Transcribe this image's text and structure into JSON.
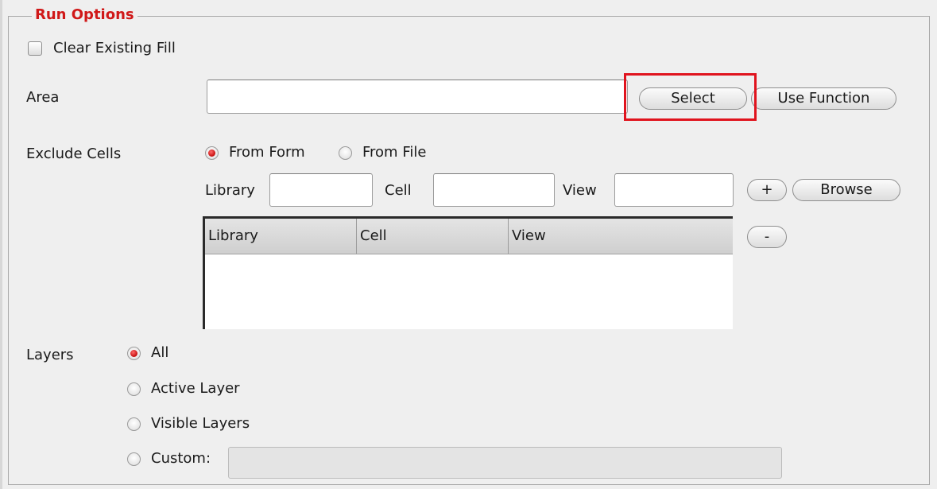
{
  "run_options": {
    "legend": "Run Options",
    "clear_existing_fill": {
      "label": "Clear Existing Fill",
      "checked": false
    },
    "area": {
      "label": "Area",
      "value": "",
      "select_button": "Select",
      "use_function_button": "Use Function"
    },
    "exclude_cells": {
      "label": "Exclude Cells",
      "source_options": [
        {
          "label": "From Form",
          "selected": true
        },
        {
          "label": "From File",
          "selected": false
        }
      ],
      "library_label": "Library",
      "cell_label": "Cell",
      "view_label": "View",
      "library_value": "",
      "cell_value": "",
      "view_value": "",
      "add_button": "+",
      "browse_button": "Browse",
      "remove_button": "-",
      "table": {
        "columns": [
          "Library",
          "Cell",
          "View"
        ],
        "rows": []
      }
    },
    "layers": {
      "label": "Layers",
      "options": [
        {
          "label": "All",
          "selected": true
        },
        {
          "label": "Active Layer",
          "selected": false
        },
        {
          "label": "Visible Layers",
          "selected": false
        },
        {
          "label": "Custom:",
          "selected": false
        }
      ],
      "custom_value": ""
    }
  },
  "colors": {
    "legend": "#d01818",
    "highlight": "#e0141e",
    "radio_selected": "#c40c0c"
  }
}
